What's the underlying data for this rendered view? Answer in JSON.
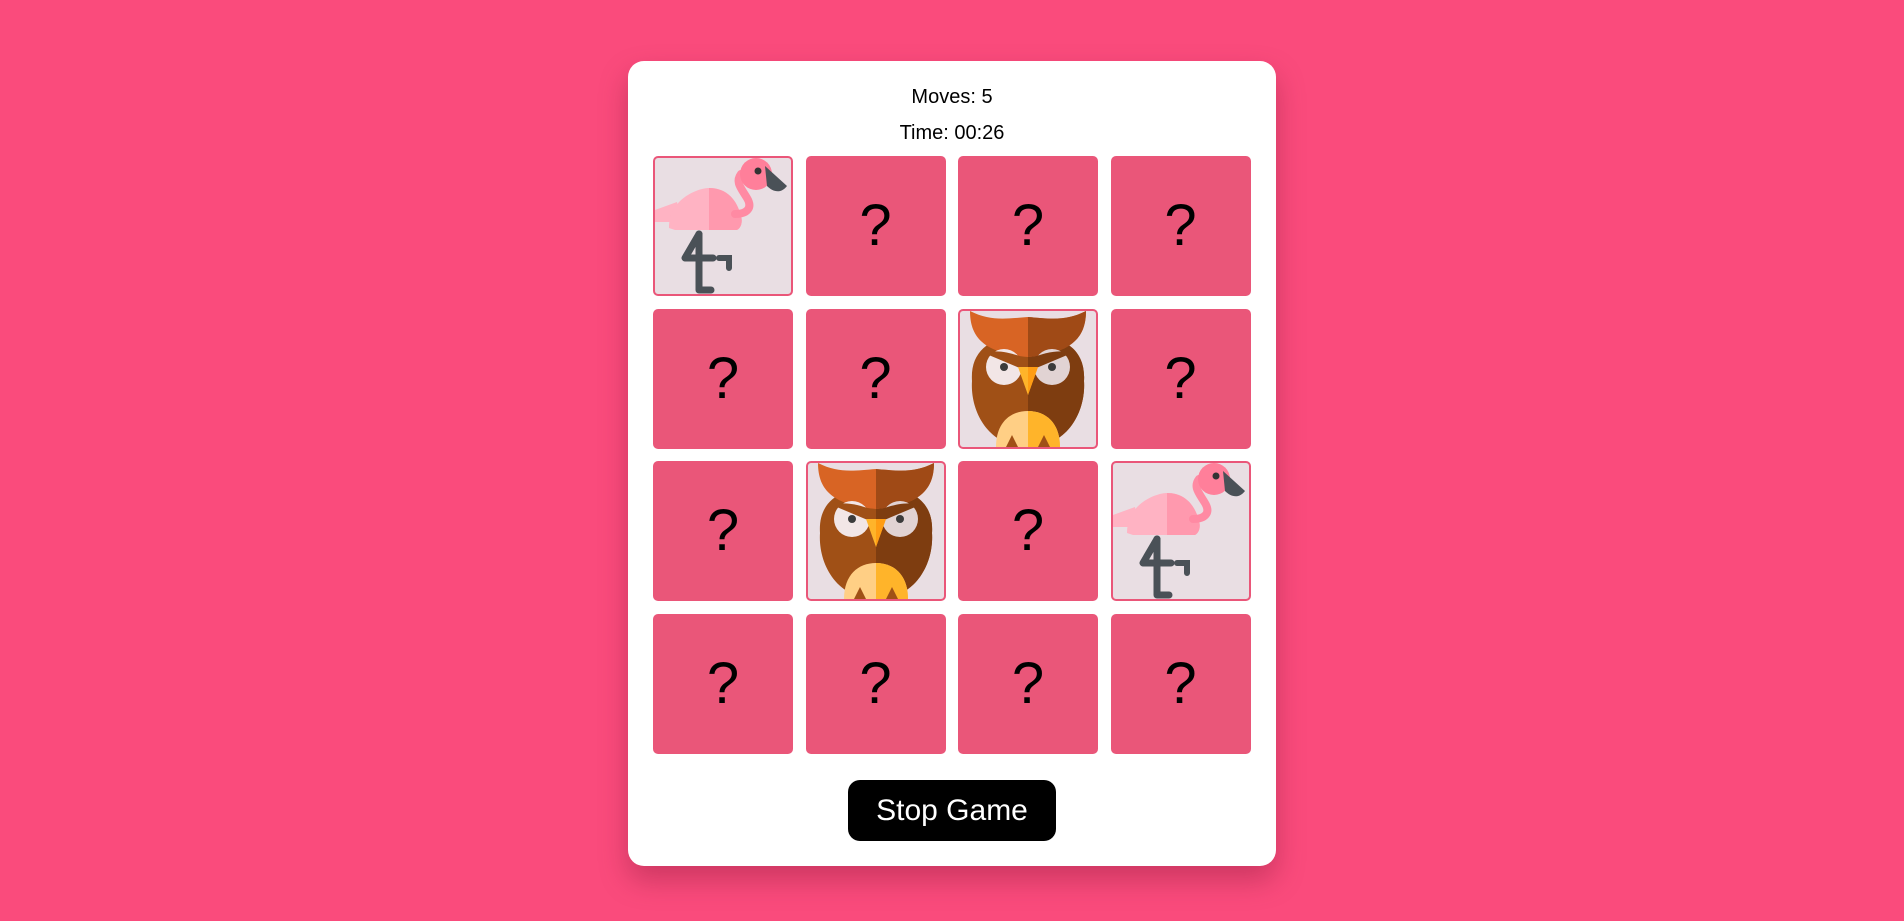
{
  "stats": {
    "moves_text": "Moves: 5",
    "time_text": "Time: 00:26"
  },
  "board": {
    "rows": 4,
    "columns": 4,
    "hidden_symbol": "?",
    "cards": [
      {
        "state": "revealed",
        "animal": "flamingo"
      },
      {
        "state": "hidden",
        "label": "?"
      },
      {
        "state": "hidden",
        "label": "?"
      },
      {
        "state": "hidden",
        "label": "?"
      },
      {
        "state": "hidden",
        "label": "?"
      },
      {
        "state": "hidden",
        "label": "?"
      },
      {
        "state": "revealed",
        "animal": "owl"
      },
      {
        "state": "hidden",
        "label": "?"
      },
      {
        "state": "hidden",
        "label": "?"
      },
      {
        "state": "revealed",
        "animal": "owl"
      },
      {
        "state": "hidden",
        "label": "?"
      },
      {
        "state": "revealed",
        "animal": "flamingo"
      },
      {
        "state": "hidden",
        "label": "?"
      },
      {
        "state": "hidden",
        "label": "?"
      },
      {
        "state": "hidden",
        "label": "?"
      },
      {
        "state": "hidden",
        "label": "?"
      }
    ]
  },
  "controls": {
    "stop_label": "Stop Game"
  },
  "colors": {
    "background": "#fa4b7c",
    "card_hidden": "#ea5679",
    "card_revealed": "#e9dee3",
    "button": "#000000"
  }
}
